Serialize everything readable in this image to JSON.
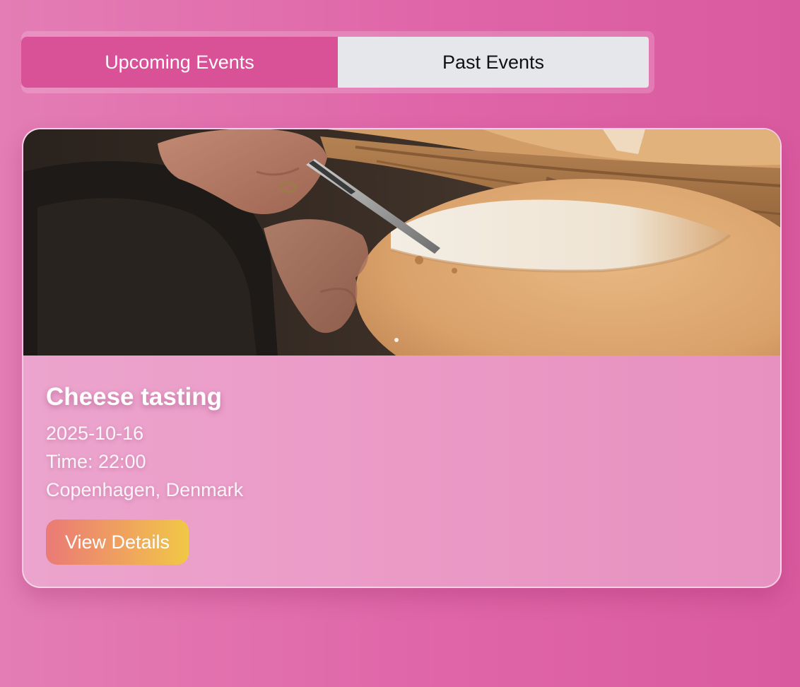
{
  "tabs": {
    "upcoming_label": "Upcoming Events",
    "past_label": "Past Events",
    "active": "upcoming"
  },
  "event": {
    "title": "Cheese tasting",
    "date": "2025-10-16",
    "time": "Time: 22:00",
    "location": "Copenhagen, Denmark",
    "details_label": "View Details",
    "image_subject": "hand cutting a wheel of cheese with a knife"
  },
  "colors": {
    "accent": "#d95298",
    "inactive_tab": "#e5e7eb",
    "button_gradient_start": "#ea7a76",
    "button_gradient_end": "#f1c846"
  }
}
